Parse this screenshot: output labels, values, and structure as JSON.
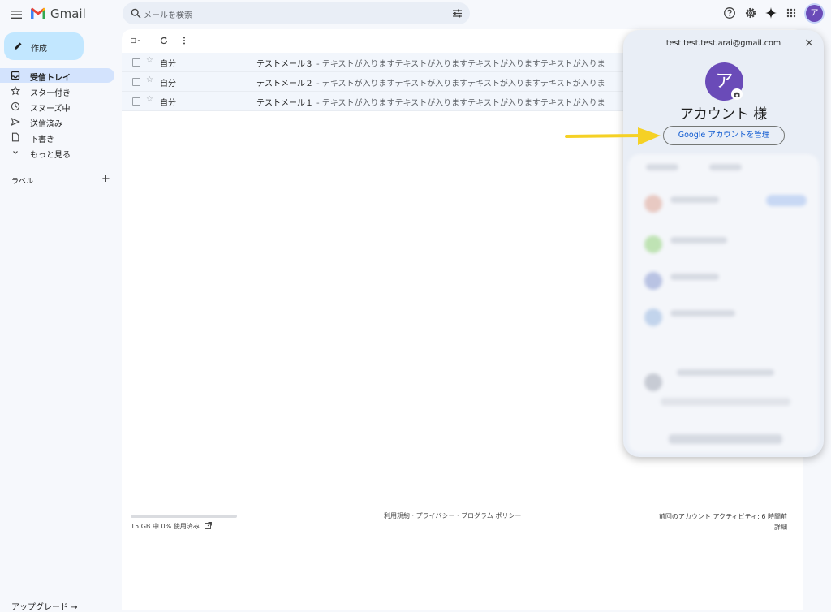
{
  "app": {
    "name": "Gmail"
  },
  "search": {
    "placeholder": "メールを検索"
  },
  "compose": {
    "label": "作成"
  },
  "sidebar": {
    "items": [
      {
        "label": "受信トレイ",
        "icon": "inbox-icon",
        "active": true
      },
      {
        "label": "スター付き",
        "icon": "star-icon",
        "active": false
      },
      {
        "label": "スヌーズ中",
        "icon": "clock-icon",
        "active": false
      },
      {
        "label": "送信済み",
        "icon": "send-icon",
        "active": false
      },
      {
        "label": "下書き",
        "icon": "draft-icon",
        "active": false
      },
      {
        "label": "もっと見る",
        "icon": "chevron-down-icon",
        "active": false
      }
    ],
    "labels_title": "ラベル",
    "labels_add": "+",
    "upgrade": "アップグレード →"
  },
  "emails": [
    {
      "sender": "自分",
      "subject": "テストメール３",
      "snippet": " - テキストが入りますテキストが入りますテキストが入りますテキストが入りま"
    },
    {
      "sender": "自分",
      "subject": "テストメール２",
      "snippet": " - テキストが入りますテキストが入りますテキストが入りますテキストが入りま"
    },
    {
      "sender": "自分",
      "subject": "テストメール１",
      "snippet": " - テキストが入りますテキストが入りますテキストが入りますテキストが入りま"
    }
  ],
  "footer": {
    "storage": "15 GB 中 0% 使用済み",
    "storage_used_fraction": 0.0,
    "links": "利用規約 · プライバシー · プログラム ポリシー",
    "activity": "前回のアカウント アクティビティ: 6 時間前",
    "details": "詳細"
  },
  "account": {
    "email": "test.test.test.arai@gmail.com",
    "avatar_letter": "ア",
    "name": "アカウント 様",
    "manage_label": "Google アカウントを管理",
    "close": "×"
  },
  "colors": {
    "accent": "#6a4bb8",
    "highlight_arrow": "#f5d125",
    "compose_bg": "#c2e7ff"
  }
}
